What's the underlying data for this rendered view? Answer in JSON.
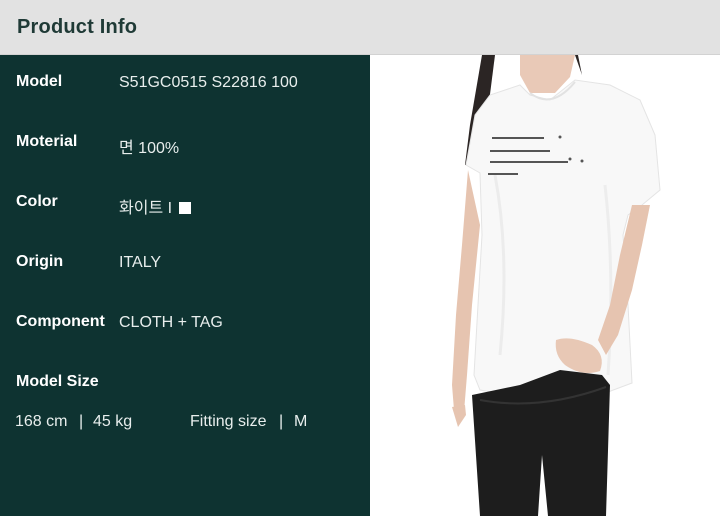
{
  "header": {
    "title": "Product Info"
  },
  "specs": [
    {
      "label": "Model",
      "value": "S51GC0515 S22816 100"
    },
    {
      "label": "Moterial",
      "value": "면 100%"
    },
    {
      "label": "Color",
      "value": "화이트 I"
    },
    {
      "label": "Origin",
      "value": "ITALY"
    },
    {
      "label": "Component",
      "value": "CLOTH + TAG"
    }
  ],
  "model_size": {
    "label": "Model Size",
    "height": "168 cm",
    "weight": "45 kg",
    "fitting_label": "Fitting size",
    "fitting_value": "M",
    "separator": "|"
  },
  "colors": {
    "header_bg": "#e2e2e2",
    "panel_bg": "#0e3331",
    "swatch": "#ffffff"
  },
  "photo": {
    "icon": "product-photo",
    "subject": "model wearing white t-shirt and black pants"
  }
}
